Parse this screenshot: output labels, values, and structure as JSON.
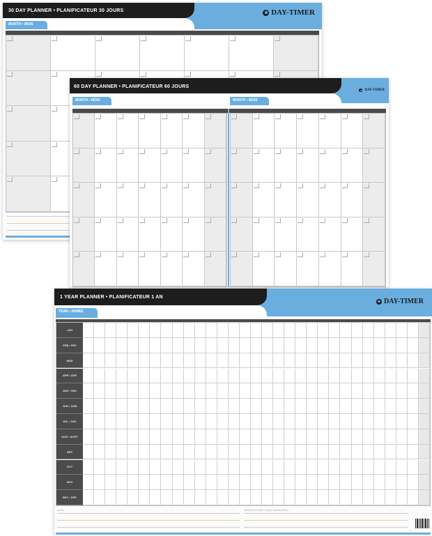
{
  "brand": "DAY-TIMER",
  "planners": [
    {
      "id": "thirty-day-back",
      "title": "30 DAY PLANNER • PLANIFICATEUR 30 JOURS",
      "tabs": [
        "MONTH • MOIS"
      ]
    },
    {
      "id": "sixty-day-middle",
      "title": "60 DAY PLANNER • PLANIFICATEUR 60 JOURS",
      "tabs": [
        "MONTH • MOIS",
        "MONTH • MOIS"
      ]
    },
    {
      "id": "one-year-front",
      "title": "1 YEAR PLANNER • PLANIFICATEUR 1 AN",
      "tabs": [
        "YEAR • ANNÉE"
      ],
      "months": [
        "JAN",
        "FEB • FÉV",
        "MAR",
        "APR • AVR",
        "MAY • MAI",
        "JUN • JUIN",
        "JUL • JUIL",
        "AUG • AOÛT",
        "SEP",
        "OCT",
        "NOV",
        "DEC • DÉC"
      ],
      "notes_label": "NOTES",
      "notes_label_right": "IMPORTANT DATES • DATES IMPORTANTES"
    }
  ],
  "colors": {
    "accent_blue": "#6aaee0",
    "header_black": "#1d1d1d",
    "label_gray": "#4b4b4b"
  }
}
